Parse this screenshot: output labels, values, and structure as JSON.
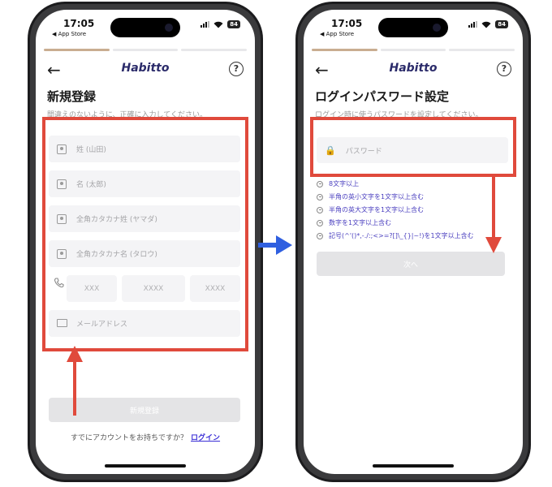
{
  "status": {
    "time": "17:05",
    "back_app": "◀ App Store",
    "battery": "84"
  },
  "brand": {
    "logo": "Habitto"
  },
  "left_screen": {
    "title": "新規登録",
    "subtitle": "間違えのないように、正確に入力してください。",
    "fields": {
      "last_name": "姓 (山田)",
      "first_name": "名 (太郎)",
      "last_kana": "全角カタカナ姓 (ヤマダ)",
      "first_kana": "全角カタカナ名 (タロウ)",
      "tel1": "XXX",
      "tel2": "XXXX",
      "tel3": "XXXX",
      "email": "メールアドレス"
    },
    "submit_label": "新規登録",
    "login_prompt": "すでにアカウントをお持ちですか？",
    "login_link": "ログイン"
  },
  "right_screen": {
    "title": "ログインパスワード設定",
    "subtitle": "ログイン時に使うパスワードを設定してください。",
    "password_placeholder": "パスワード",
    "rules": [
      "8文字以上",
      "半角の英小文字を1文字以上含む",
      "半角の英大文字を1文字以上含む",
      "数字を1文字以上含む",
      "記号(^'()*,-./:;<>=?[]\\_{}|~!)を1文字以上含む"
    ],
    "next_label": "次へ"
  },
  "colors": {
    "highlight": "#e04a3c",
    "arrow_blue": "#2f5fe0",
    "link": "#3b2fd6",
    "progress": "#c9ad91"
  }
}
